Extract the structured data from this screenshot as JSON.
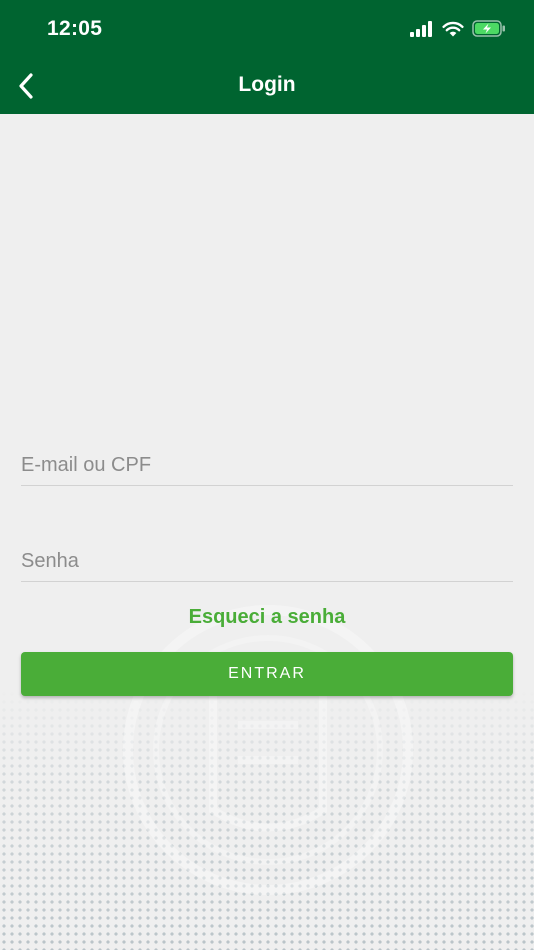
{
  "status_bar": {
    "time": "12:05",
    "icons": [
      "cellular-signal-icon",
      "wifi-icon",
      "battery-charging-icon"
    ],
    "battery_color": "#4cd964"
  },
  "nav": {
    "title": "Login",
    "back_icon": "chevron-left-icon"
  },
  "form": {
    "email_placeholder": "E-mail ou CPF",
    "email_value": "",
    "password_placeholder": "Senha",
    "password_value": "",
    "forgot_label": "Esqueci a senha",
    "submit_label": "ENTRAR"
  },
  "colors": {
    "header_bg": "#006430",
    "accent": "#4aad38",
    "page_bg": "#efefef"
  }
}
